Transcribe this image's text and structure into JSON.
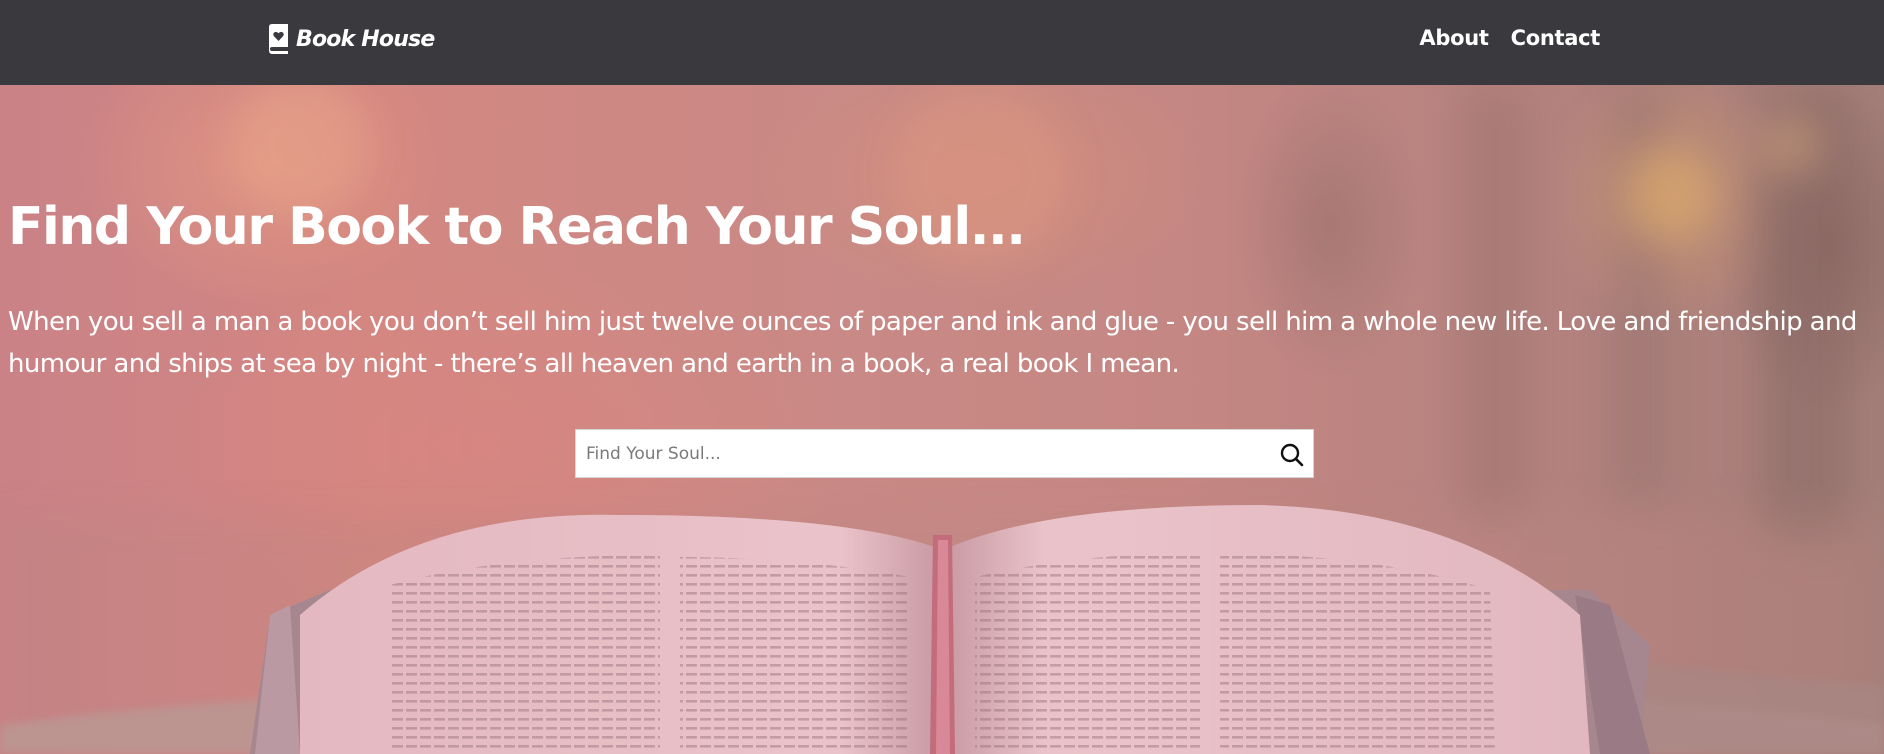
{
  "navbar": {
    "brand": "Book House",
    "links": [
      "About",
      "Contact"
    ]
  },
  "hero": {
    "title": "Find Your Book to Reach Your Soul...",
    "quote": "When you sell a man a book you don’t sell him just twelve ounces of paper and ink and glue - you sell him a whole new life. Love and friendship and humour and ships at sea by night - there’s all heaven and earth in a book, a real book I mean."
  },
  "search": {
    "placeholder": "Find Your Soul...",
    "value": ""
  },
  "icons": {
    "brand": "book-heart-icon",
    "search": "search-icon"
  }
}
